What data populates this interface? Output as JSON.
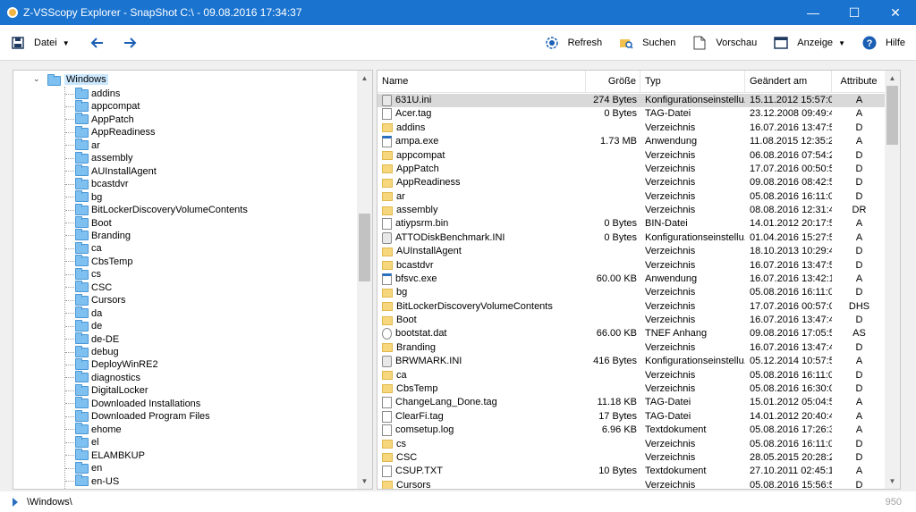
{
  "window": {
    "title": "Z-VSScopy Explorer - SnapShot C:\\ - 09.08.2016 17:34:37",
    "minimize": "—",
    "maximize": "☐",
    "close": "✕"
  },
  "toolbar": {
    "datei": "Datei",
    "refresh": "Refresh",
    "suchen": "Suchen",
    "vorschau": "Vorschau",
    "anzeige": "Anzeige",
    "hilfe": "Hilfe"
  },
  "tree": {
    "root": "Windows",
    "items": [
      "addins",
      "appcompat",
      "AppPatch",
      "AppReadiness",
      "ar",
      "assembly",
      "AUInstallAgent",
      "bcastdvr",
      "bg",
      "BitLockerDiscoveryVolumeContents",
      "Boot",
      "Branding",
      "ca",
      "CbsTemp",
      "cs",
      "CSC",
      "Cursors",
      "da",
      "de",
      "de-DE",
      "debug",
      "DeployWinRE2",
      "diagnostics",
      "DigitalLocker",
      "Downloaded Installations",
      "Downloaded Program Files",
      "ehome",
      "el",
      "ELAMBKUP",
      "en",
      "en-US"
    ]
  },
  "list": {
    "columns": {
      "name": "Name",
      "size": "Größe",
      "type": "Typ",
      "date": "Geändert am",
      "attr": "Attribute"
    },
    "rows": [
      {
        "icon": "ini",
        "name": "631U.ini",
        "size": "274 Bytes",
        "type": "Konfigurationseinstellu...",
        "date": "15.11.2012 15:57:05",
        "attr": "A"
      },
      {
        "icon": "file",
        "name": "Acer.tag",
        "size": "0 Bytes",
        "type": "TAG-Datei",
        "date": "23.12.2008 09:49:45",
        "attr": "A"
      },
      {
        "icon": "folder",
        "name": "addins",
        "size": "",
        "type": "Verzeichnis",
        "date": "16.07.2016 13:47:50",
        "attr": "D"
      },
      {
        "icon": "exe",
        "name": "ampa.exe",
        "size": "1.73 MB",
        "type": "Anwendung",
        "date": "11.08.2015 12:35:20",
        "attr": "A"
      },
      {
        "icon": "folder",
        "name": "appcompat",
        "size": "",
        "type": "Verzeichnis",
        "date": "06.08.2016 07:54:23",
        "attr": "D"
      },
      {
        "icon": "folder",
        "name": "AppPatch",
        "size": "",
        "type": "Verzeichnis",
        "date": "17.07.2016 00:50:51",
        "attr": "D"
      },
      {
        "icon": "folder",
        "name": "AppReadiness",
        "size": "",
        "type": "Verzeichnis",
        "date": "09.08.2016 08:42:56",
        "attr": "D"
      },
      {
        "icon": "folder",
        "name": "ar",
        "size": "",
        "type": "Verzeichnis",
        "date": "05.08.2016 16:11:07",
        "attr": "D"
      },
      {
        "icon": "folder",
        "name": "assembly",
        "size": "",
        "type": "Verzeichnis",
        "date": "08.08.2016 12:31:47",
        "attr": "DR"
      },
      {
        "icon": "file",
        "name": "atiypsrm.bin",
        "size": "0 Bytes",
        "type": "BIN-Datei",
        "date": "14.01.2012 20:17:59",
        "attr": "A"
      },
      {
        "icon": "ini",
        "name": "ATTODiskBenchmark.INI",
        "size": "0 Bytes",
        "type": "Konfigurationseinstellu...",
        "date": "01.04.2016 15:27:50",
        "attr": "A"
      },
      {
        "icon": "folder",
        "name": "AUInstallAgent",
        "size": "",
        "type": "Verzeichnis",
        "date": "18.10.2013 10:29:47",
        "attr": "D"
      },
      {
        "icon": "folder",
        "name": "bcastdvr",
        "size": "",
        "type": "Verzeichnis",
        "date": "16.07.2016 13:47:50",
        "attr": "D"
      },
      {
        "icon": "exe",
        "name": "bfsvc.exe",
        "size": "60.00 KB",
        "type": "Anwendung",
        "date": "16.07.2016 13:42:16",
        "attr": "A"
      },
      {
        "icon": "folder",
        "name": "bg",
        "size": "",
        "type": "Verzeichnis",
        "date": "05.08.2016 16:11:07",
        "attr": "D"
      },
      {
        "icon": "folder",
        "name": "BitLockerDiscoveryVolumeContents",
        "size": "",
        "type": "Verzeichnis",
        "date": "17.07.2016 00:57:00",
        "attr": "DHS"
      },
      {
        "icon": "folder",
        "name": "Boot",
        "size": "",
        "type": "Verzeichnis",
        "date": "16.07.2016 13:47:48",
        "attr": "D"
      },
      {
        "icon": "tnef",
        "name": "bootstat.dat",
        "size": "66.00 KB",
        "type": "TNEF Anhang",
        "date": "09.08.2016 17:05:59",
        "attr": "AS"
      },
      {
        "icon": "folder",
        "name": "Branding",
        "size": "",
        "type": "Verzeichnis",
        "date": "16.07.2016 13:47:48",
        "attr": "D"
      },
      {
        "icon": "ini",
        "name": "BRWMARK.INI",
        "size": "416 Bytes",
        "type": "Konfigurationseinstellu...",
        "date": "05.12.2014 10:57:54",
        "attr": "A"
      },
      {
        "icon": "folder",
        "name": "ca",
        "size": "",
        "type": "Verzeichnis",
        "date": "05.08.2016 16:11:07",
        "attr": "D"
      },
      {
        "icon": "folder",
        "name": "CbsTemp",
        "size": "",
        "type": "Verzeichnis",
        "date": "05.08.2016 16:30:00",
        "attr": "D"
      },
      {
        "icon": "file",
        "name": "ChangeLang_Done.tag",
        "size": "11.18 KB",
        "type": "TAG-Datei",
        "date": "15.01.2012 05:04:54",
        "attr": "A"
      },
      {
        "icon": "file",
        "name": "ClearFi.tag",
        "size": "17 Bytes",
        "type": "TAG-Datei",
        "date": "14.01.2012 20:40:42",
        "attr": "A"
      },
      {
        "icon": "file",
        "name": "comsetup.log",
        "size": "6.96 KB",
        "type": "Textdokument",
        "date": "05.08.2016 17:26:30",
        "attr": "A"
      },
      {
        "icon": "folder",
        "name": "cs",
        "size": "",
        "type": "Verzeichnis",
        "date": "05.08.2016 16:11:07",
        "attr": "D"
      },
      {
        "icon": "folder",
        "name": "CSC",
        "size": "",
        "type": "Verzeichnis",
        "date": "28.05.2015 20:28:26",
        "attr": "D"
      },
      {
        "icon": "file",
        "name": "CSUP.TXT",
        "size": "10 Bytes",
        "type": "Textdokument",
        "date": "27.10.2011 02:45:10",
        "attr": "A"
      },
      {
        "icon": "folder",
        "name": "Cursors",
        "size": "",
        "type": "Verzeichnis",
        "date": "05.08.2016 15:56:54",
        "attr": "D"
      }
    ]
  },
  "status": {
    "path": "\\Windows\\",
    "count": "950"
  }
}
